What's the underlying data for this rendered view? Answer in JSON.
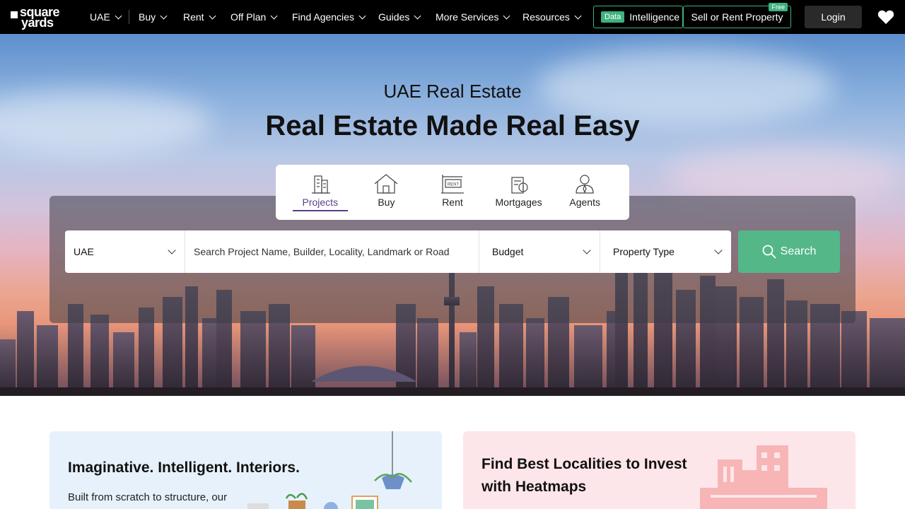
{
  "brand": {
    "line1": "square",
    "line2": "yards"
  },
  "nav": {
    "items": [
      {
        "label": "UAE"
      },
      {
        "label": "Buy"
      },
      {
        "label": "Rent"
      },
      {
        "label": "Off Plan"
      },
      {
        "label": "Find Agencies"
      },
      {
        "label": "Guides"
      },
      {
        "label": "More Services"
      },
      {
        "label": "Resources"
      }
    ],
    "intel_tag": "Data",
    "intel_label": "Intelligence",
    "sell_label": "Sell or Rent Property",
    "free_tag": "Free",
    "login_label": "Login"
  },
  "hero": {
    "subtitle": "UAE Real Estate",
    "title": "Real Estate Made Real Easy",
    "tabs": [
      {
        "label": "Projects",
        "icon": "building-icon",
        "active": true
      },
      {
        "label": "Buy",
        "icon": "house-icon",
        "active": false
      },
      {
        "label": "Rent",
        "icon": "rent-sign-icon",
        "active": false
      },
      {
        "label": "Mortgages",
        "icon": "mortgage-icon",
        "active": false
      },
      {
        "label": "Agents",
        "icon": "agent-icon",
        "active": false
      }
    ]
  },
  "search": {
    "location": "UAE",
    "placeholder": "Search Project Name, Builder, Locality, Landmark or Road",
    "budget": "Budget",
    "property_type": "Property Type",
    "button_label": "Search"
  },
  "cards": {
    "interiors": {
      "title": "Imaginative. Intelligent. Interiors.",
      "desc": "Built from scratch to structure, our"
    },
    "heatmaps": {
      "title": "Find Best Localities to Invest with Heatmaps"
    }
  },
  "colors": {
    "accent_green": "#54b788",
    "nav_green": "#3fb27f",
    "active_tab": "#5a3d8a"
  }
}
